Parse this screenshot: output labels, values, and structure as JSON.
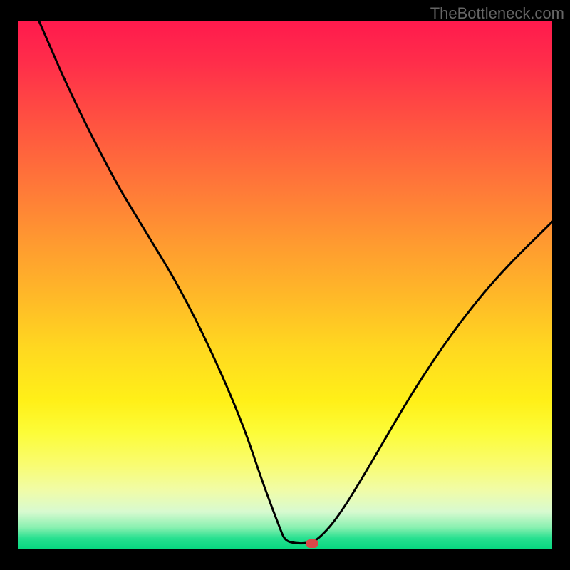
{
  "watermark": "TheBottleneck.com",
  "chart_data": {
    "type": "line",
    "title": "",
    "xlabel": "",
    "ylabel": "",
    "xlim": [
      0,
      100
    ],
    "ylim": [
      0,
      100
    ],
    "background_gradient": {
      "top": "#ff1a4d",
      "bottom": "#08d880",
      "description": "red to green vertical gradient"
    },
    "series": [
      {
        "name": "bottleneck-curve",
        "description": "V-shaped curve; two branches meeting near bottom; left branch descends from top-left, right branch rises to upper-right",
        "points": [
          {
            "x": 4,
            "y": 100
          },
          {
            "x": 10,
            "y": 86
          },
          {
            "x": 18,
            "y": 70
          },
          {
            "x": 24,
            "y": 60
          },
          {
            "x": 30,
            "y": 50
          },
          {
            "x": 36,
            "y": 38
          },
          {
            "x": 42,
            "y": 24
          },
          {
            "x": 46,
            "y": 12
          },
          {
            "x": 49,
            "y": 4
          },
          {
            "x": 50,
            "y": 1.5
          },
          {
            "x": 52,
            "y": 1
          },
          {
            "x": 54,
            "y": 1
          },
          {
            "x": 56,
            "y": 1.5
          },
          {
            "x": 60,
            "y": 6
          },
          {
            "x": 66,
            "y": 16
          },
          {
            "x": 74,
            "y": 30
          },
          {
            "x": 82,
            "y": 42
          },
          {
            "x": 90,
            "y": 52
          },
          {
            "x": 100,
            "y": 62
          }
        ]
      }
    ],
    "marker": {
      "name": "target-point",
      "x": 55,
      "y": 1,
      "color": "#d94848"
    }
  }
}
